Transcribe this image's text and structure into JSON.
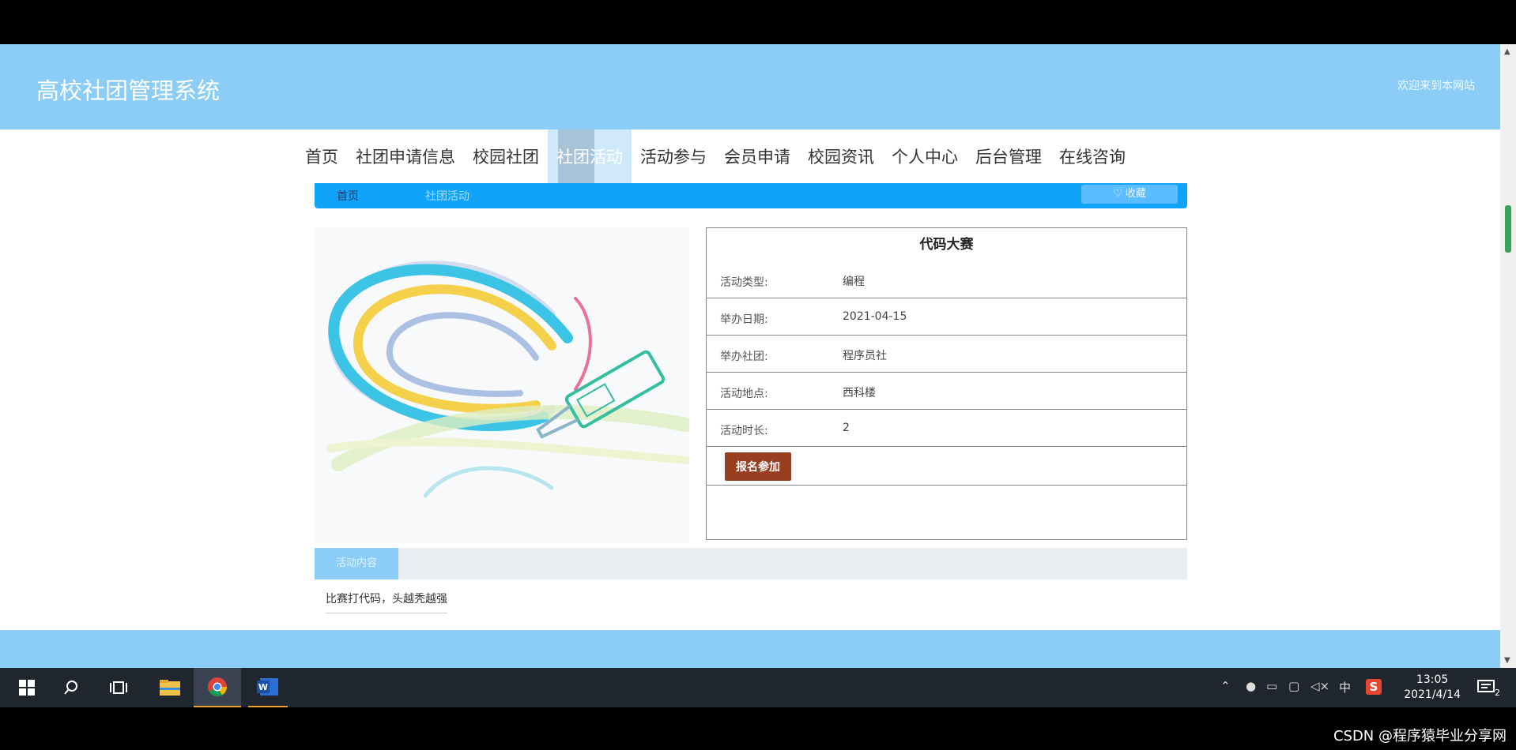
{
  "header": {
    "site_title": "高校社团管理系统",
    "welcome": "欢迎来到本网站"
  },
  "nav": [
    {
      "label": "首页"
    },
    {
      "label": "社团申请信息"
    },
    {
      "label": "校园社团"
    },
    {
      "label": "社团活动",
      "active": true
    },
    {
      "label": "活动参与"
    },
    {
      "label": "会员申请"
    },
    {
      "label": "校园资讯"
    },
    {
      "label": "个人中心"
    },
    {
      "label": "后台管理"
    },
    {
      "label": "在线咨询"
    }
  ],
  "breadcrumb": {
    "home": "首页",
    "current": "社团活动",
    "favorite_button": "收藏"
  },
  "activity": {
    "title": "代码大赛",
    "fields": [
      {
        "label": "活动类型:",
        "value": "编程"
      },
      {
        "label": "举办日期:",
        "value": "2021-04-15"
      },
      {
        "label": "举办社团:",
        "value": "程序员社"
      },
      {
        "label": "活动地点:",
        "value": "西科楼"
      },
      {
        "label": "活动时长:",
        "value": "2"
      }
    ],
    "join_button": "报名参加"
  },
  "tabs": {
    "active": "活动内容"
  },
  "content": {
    "text": "比赛打代码，头越秃越强"
  },
  "taskbar": {
    "time": "13:05",
    "date": "2021/4/14",
    "ime": "中",
    "notification_count": "2",
    "accent": "#f0a030"
  },
  "watermark": "CSDN @程序猿毕业分享网"
}
